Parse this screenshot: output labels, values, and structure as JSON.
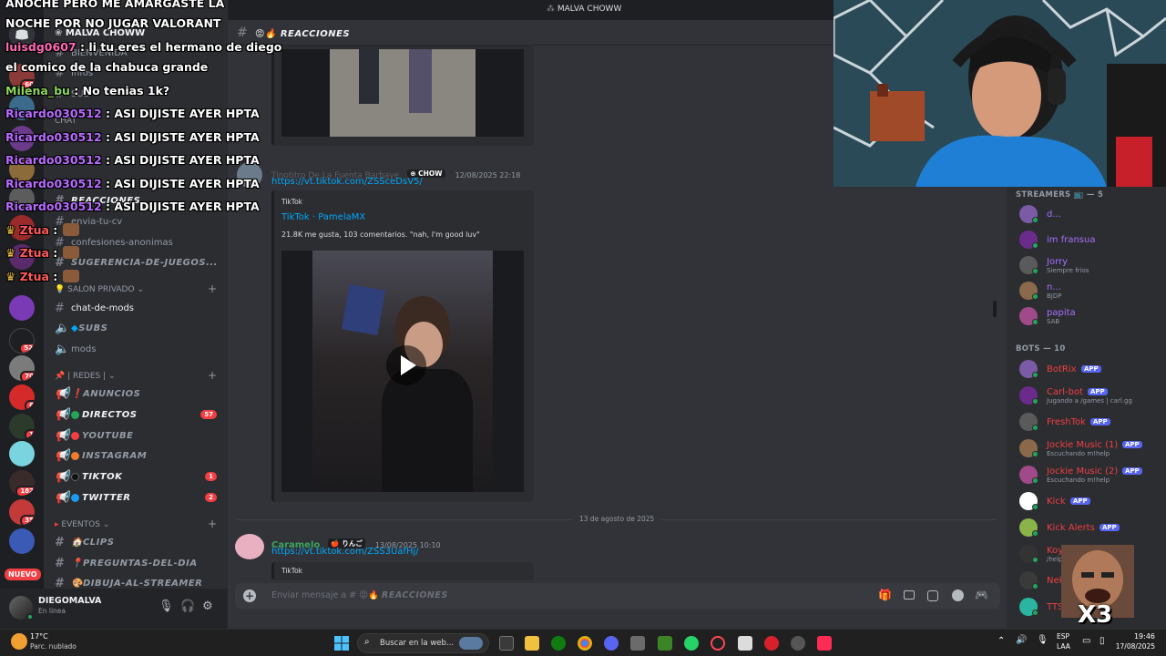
{
  "server": {
    "name": "MALVA CHOWW",
    "rail_badges": [
      "60",
      "2",
      "52",
      "70",
      "6",
      "1",
      "182",
      "35"
    ],
    "new_label": "NUEVO"
  },
  "sidebar": {
    "welcome": "BIENVENIDA",
    "info": "Infos",
    "sub_tag": "SUB",
    "chat_cat": "CHAT",
    "reactions": "REACCIONES",
    "envia": "envia-tu-cv",
    "confesiones": "confesiones-anonimas",
    "sugerencia": "SUGERENCIA-DE-JUEGOS...",
    "salon_privado": "SALON PRIVADO",
    "chat_de_mods": "chat-de-mods",
    "subs": "SUBS",
    "mods": "mods",
    "redes": "| REDES |",
    "anuncios": "ANUNCIOS",
    "directos": "DIRECTOS",
    "directos_badge": "57",
    "youtube": "YOUTUBE",
    "instagram": "INSTAGRAM",
    "tiktok": "TIKTOK",
    "tiktok_badge": "1",
    "twitter": "TWITTER",
    "twitter_badge": "2",
    "eventos": "EVENTOS",
    "clips": "CLIPS",
    "preguntas": "PREGUNTAS-DEL-DIA",
    "dibuja": "DIBUJA-AL-STREAMER"
  },
  "user": {
    "name": "DIEGOMALVA",
    "status": "En linea"
  },
  "chat": {
    "topbar_title": "MALVA CHOWW",
    "channel": "REACCIONES",
    "message1": {
      "author": "Tinotitro De La Fuenta Barbaye",
      "tag": "CHOW",
      "time": "12/08/2025 22:18",
      "link": "https://vt.tiktok.com/ZSSceDsV5/",
      "provider": "TikTok",
      "embed_title": "TikTok · PamelaMX",
      "embed_desc": "21.8K me gusta, 103 comentarios. \"nah, I'm good luv\""
    },
    "date_divider": "13 de agosto de 2025",
    "message2": {
      "author": "Caramelo",
      "tag": "りんご",
      "time": "13/08/2025 10:10",
      "link": "https://vt.tiktok.com/ZSS3UafHj/",
      "provider": "TikTok"
    },
    "composer_placeholder": "Enviar mensaje a #",
    "composer_channel": "REACCIONES"
  },
  "members": {
    "streamers_header": "STREAMERS",
    "streamers_count": "— 5",
    "streamers": [
      {
        "name": "d...",
        "sub": "",
        "color": "#a970ff"
      },
      {
        "name": "im fransua",
        "sub": "",
        "color": "#a970ff"
      },
      {
        "name": "Jorry",
        "sub": "Siempre frios",
        "color": "#a970ff"
      },
      {
        "name": "n...",
        "sub": "BJDP",
        "color": "#a970ff"
      },
      {
        "name": "papita",
        "sub": "SAB",
        "color": "#a970ff"
      }
    ],
    "bots_header": "BOTS — 10",
    "bots": [
      {
        "name": "BotRix",
        "sub": "",
        "app": "APP",
        "color": "#f23f43"
      },
      {
        "name": "Carl-bot",
        "sub": "Jugando a /games | carl.gg",
        "app": "APP",
        "color": "#f23f43"
      },
      {
        "name": "FreshTok",
        "sub": "",
        "app": "APP",
        "color": "#f23f43"
      },
      {
        "name": "Jockie Music (1)",
        "sub": "Escuchando m!help",
        "app": "APP",
        "color": "#f23f43"
      },
      {
        "name": "Jockie Music (2)",
        "sub": "Escuchando m!help",
        "app": "APP",
        "color": "#f23f43"
      },
      {
        "name": "Kick",
        "sub": "",
        "app": "APP",
        "color": "#f23f43"
      },
      {
        "name": "Kick Alerts",
        "sub": "",
        "app": "APP",
        "color": "#f23f43"
      },
      {
        "name": "Koy...",
        "sub": "/help",
        "app": "",
        "color": "#f23f43"
      },
      {
        "name": "Nek...",
        "sub": "",
        "app": "",
        "color": "#f23f43"
      },
      {
        "name": "TTS...",
        "sub": "",
        "app": "",
        "color": "#f23f43"
      }
    ]
  },
  "stream_chat": {
    "lines": [
      {
        "user": "",
        "text": "ANOCHE PERO ME AMARGASTE LA",
        "color": "#ffffff"
      },
      {
        "user": "",
        "text": "NOCHE POR NO JUGAR VALORANT",
        "color": "#ffffff"
      },
      {
        "user": "luisdg0607",
        "text": ": li tu eres el hermano de diego",
        "color": "#ff69b4"
      },
      {
        "user": "",
        "text": "el comico de la chabuca grande",
        "color": "#ffffff"
      },
      {
        "user": "Milena_bu",
        "text": ": No tenias 1k?",
        "color": "#8bd65c"
      },
      {
        "user": "Ricardo030512",
        "text": ": ASI DIJISTE AYER HPTA",
        "color": "#b86bff"
      },
      {
        "user": "Ricardo030512",
        "text": ": ASI DIJISTE AYER HPTA",
        "color": "#b86bff"
      },
      {
        "user": "Ricardo030512",
        "text": ": ASI DIJISTE AYER HPTA",
        "color": "#b86bff"
      },
      {
        "user": "Ricardo030512",
        "text": ": ASI DIJISTE AYER HPTA",
        "color": "#b86bff"
      },
      {
        "user": "Ricardo030512",
        "text": ": ASI DIJISTE AYER HPTA",
        "color": "#b86bff"
      },
      {
        "user": "Ztua",
        "text": ":",
        "color": "#ff5a5a"
      },
      {
        "user": "Ztua",
        "text": ":",
        "color": "#ff5a5a"
      },
      {
        "user": "Ztua",
        "text": ":",
        "color": "#ff5a5a"
      }
    ]
  },
  "meme_caption": "X3",
  "taskbar": {
    "weather_temp": "17°C",
    "weather_desc": "Parc. nublado",
    "search_placeholder": "Buscar en la web...",
    "lang": "ESP",
    "lang2": "LAA",
    "time": "19:46",
    "date": "17/08/2025"
  }
}
